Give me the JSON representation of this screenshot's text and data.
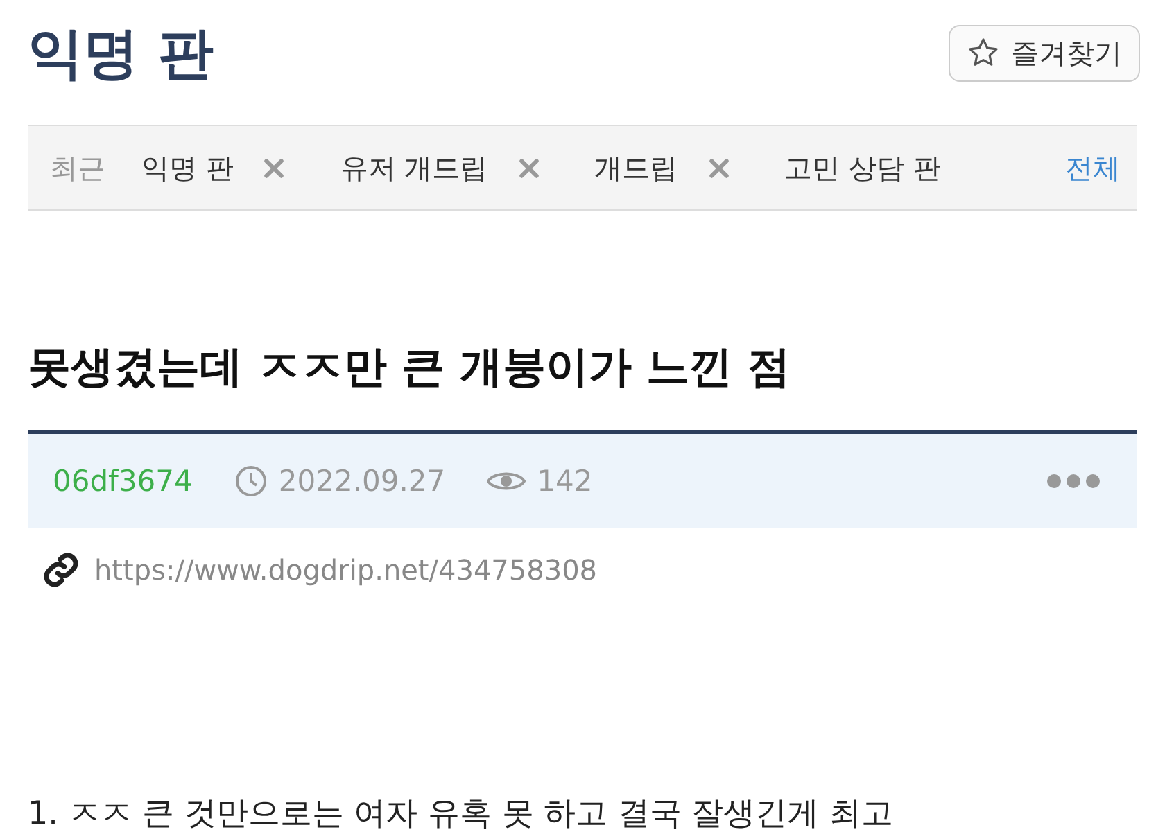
{
  "board_title": "익명 판",
  "favorite_button": {
    "label": "즐겨찾기"
  },
  "recent": {
    "label": "최근",
    "items": [
      {
        "label": "익명 판"
      },
      {
        "label": "유저 개드립"
      },
      {
        "label": "개드립"
      },
      {
        "label": "고민 상담 판"
      }
    ],
    "all_link": "전체"
  },
  "post": {
    "title": "못생겼는데 ㅈㅈ만 큰 개붕이가 느낀 점",
    "author": "06df3674",
    "date": "2022.09.27",
    "views": "142",
    "url": "https://www.dogdrip.net/434758308"
  },
  "body": [
    "1. ㅈㅈ 큰 것만으로는 여자 유혹 못 하고 결국 잘생긴게 최고"
  ]
}
